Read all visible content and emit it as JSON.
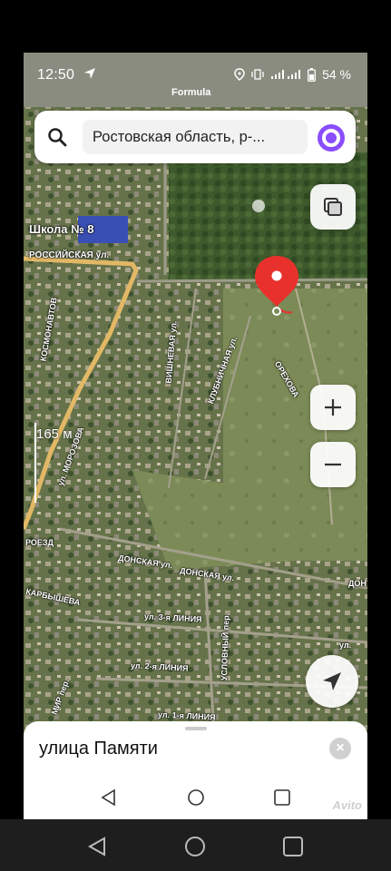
{
  "status_bar": {
    "time": "12:50",
    "battery": "54 %",
    "icons": [
      "navigation-arrow-icon",
      "location-icon",
      "vibrate-icon",
      "signal-icon",
      "battery-icon"
    ]
  },
  "map": {
    "formula_label": "Formula",
    "school_label": "Школа № 8",
    "scale_label": "165 м",
    "street_labels": {
      "rossiyskaya": "РОССИЙСКАЯ ул.",
      "kosmonavtov": "КОСМОНАВТОВ",
      "vishnevaya": "ВИШНЕВАЯ ул.",
      "klubnichnaya": "КЛУБНИЧНАЯ ул.",
      "orekhovaya": "ОРЕХОВА",
      "morozova": "ул. МОРОЗОВА",
      "proezd": "РОЕЗД",
      "donskaya1": "ДОНСКАЯ ул.",
      "donskaya2": "ДОНСКАЯ ул.",
      "donskaya3": "ДОН",
      "karbysheva": "КАРБЫШЕВА",
      "liniya3": "ул. 3-я ЛИНИЯ",
      "liniya2": "ул. 2-я ЛИНИЯ",
      "liniya1": "ул. 1-я ЛИНИЯ",
      "uslovny": "УСЛОВНЫЙ пер.",
      "mir": "МИР пер.",
      "ul": "ул."
    },
    "pin_color": "#e8312d",
    "road_color": "#e2b866"
  },
  "search": {
    "value": "Ростовская область, р-...",
    "alice_color": "#8a4dff"
  },
  "sheet": {
    "title": "улица Памяти",
    "watermark": "Avito"
  },
  "icons": {
    "search": "search-icon",
    "layers": "layers-icon",
    "zoom_in": "plus-icon",
    "zoom_out": "minus-icon",
    "locate": "navigation-arrow-icon",
    "close": "close-icon"
  }
}
